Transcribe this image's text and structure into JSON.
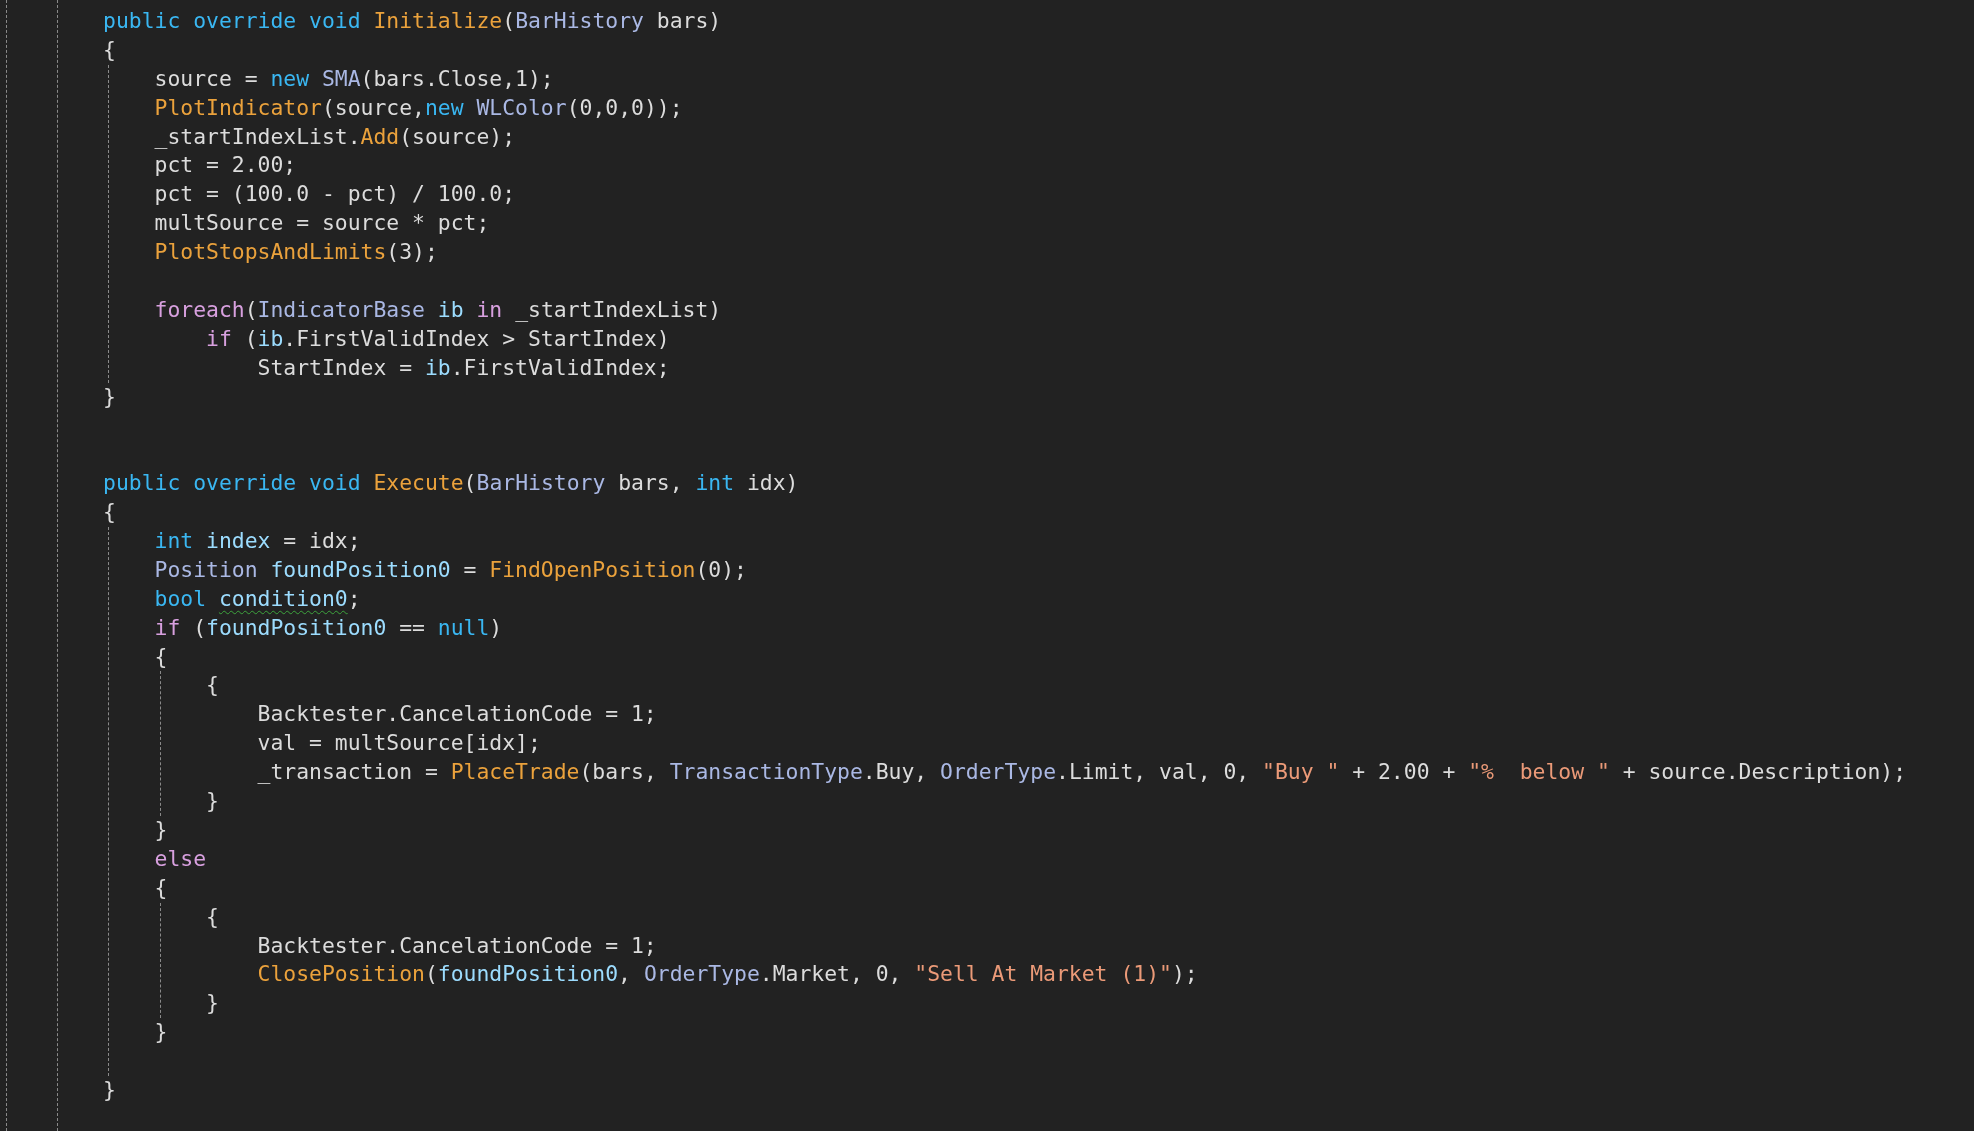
{
  "editor": {
    "code": [
      {
        "kind": "line",
        "tokens": [
          {
            "text": "public override void ",
            "kind": "keyword"
          },
          {
            "text": "Initialize",
            "kind": "method"
          },
          {
            "text": "(",
            "kind": "plain"
          },
          {
            "text": "BarHistory",
            "kind": "type"
          },
          {
            "text": " bars)",
            "kind": "plain"
          }
        ]
      },
      {
        "kind": "line",
        "tokens": [
          {
            "text": "{",
            "kind": "plain"
          }
        ]
      },
      {
        "kind": "block",
        "guide": true,
        "children": [
          {
            "kind": "line",
            "tokens": [
              {
                "text": "source = ",
                "kind": "plain"
              },
              {
                "text": "new ",
                "kind": "keyword"
              },
              {
                "text": "SMA",
                "kind": "type"
              },
              {
                "text": "(bars.Close,1);",
                "kind": "plain"
              }
            ]
          },
          {
            "kind": "line",
            "tokens": [
              {
                "text": "PlotIndicator",
                "kind": "method"
              },
              {
                "text": "(source,",
                "kind": "plain"
              },
              {
                "text": "new ",
                "kind": "keyword"
              },
              {
                "text": "WLColor",
                "kind": "type"
              },
              {
                "text": "(0,0,0));",
                "kind": "plain"
              }
            ]
          },
          {
            "kind": "line",
            "tokens": [
              {
                "text": "_startIndexList.",
                "kind": "plain"
              },
              {
                "text": "Add",
                "kind": "method"
              },
              {
                "text": "(source);",
                "kind": "plain"
              }
            ]
          },
          {
            "kind": "line",
            "tokens": [
              {
                "text": "pct = 2.00;",
                "kind": "plain"
              }
            ]
          },
          {
            "kind": "line",
            "tokens": [
              {
                "text": "pct = (100.0 - pct) / 100.0;",
                "kind": "plain"
              }
            ]
          },
          {
            "kind": "line",
            "tokens": [
              {
                "text": "multSource = source * pct;",
                "kind": "plain"
              }
            ]
          },
          {
            "kind": "line",
            "tokens": [
              {
                "text": "PlotStopsAndLimits",
                "kind": "method"
              },
              {
                "text": "(3);",
                "kind": "plain"
              }
            ]
          },
          {
            "kind": "blank"
          },
          {
            "kind": "line",
            "tokens": [
              {
                "text": "foreach",
                "kind": "control"
              },
              {
                "text": "(",
                "kind": "plain"
              },
              {
                "text": "IndicatorBase ",
                "kind": "type"
              },
              {
                "text": "ib ",
                "kind": "local"
              },
              {
                "text": "in",
                "kind": "control"
              },
              {
                "text": " _startIndexList)",
                "kind": "plain"
              }
            ]
          },
          {
            "kind": "block",
            "guide": false,
            "children": [
              {
                "kind": "line",
                "tokens": [
                  {
                    "text": "if",
                    "kind": "control"
                  },
                  {
                    "text": " (",
                    "kind": "plain"
                  },
                  {
                    "text": "ib",
                    "kind": "local"
                  },
                  {
                    "text": ".FirstValidIndex > StartIndex)",
                    "kind": "plain"
                  }
                ]
              },
              {
                "kind": "block",
                "guide": false,
                "children": [
                  {
                    "kind": "line",
                    "tokens": [
                      {
                        "text": "StartIndex = ",
                        "kind": "plain"
                      },
                      {
                        "text": "ib",
                        "kind": "local"
                      },
                      {
                        "text": ".FirstValidIndex;",
                        "kind": "plain"
                      }
                    ]
                  }
                ]
              }
            ]
          }
        ]
      },
      {
        "kind": "line",
        "tokens": [
          {
            "text": "}",
            "kind": "plain"
          }
        ]
      },
      {
        "kind": "blank"
      },
      {
        "kind": "blank"
      },
      {
        "kind": "line",
        "tokens": [
          {
            "text": "public override void ",
            "kind": "keyword"
          },
          {
            "text": "Execute",
            "kind": "method"
          },
          {
            "text": "(",
            "kind": "plain"
          },
          {
            "text": "BarHistory",
            "kind": "type"
          },
          {
            "text": " bars, ",
            "kind": "plain"
          },
          {
            "text": "int",
            "kind": "keyword"
          },
          {
            "text": " idx)",
            "kind": "plain"
          }
        ]
      },
      {
        "kind": "line",
        "tokens": [
          {
            "text": "{",
            "kind": "plain"
          }
        ]
      },
      {
        "kind": "block",
        "guide": true,
        "children": [
          {
            "kind": "line",
            "tokens": [
              {
                "text": "int ",
                "kind": "keyword"
              },
              {
                "text": "index",
                "kind": "local"
              },
              {
                "text": " = idx;",
                "kind": "plain"
              }
            ]
          },
          {
            "kind": "line",
            "tokens": [
              {
                "text": "Position ",
                "kind": "type"
              },
              {
                "text": "foundPosition0",
                "kind": "local"
              },
              {
                "text": " = ",
                "kind": "plain"
              },
              {
                "text": "FindOpenPosition",
                "kind": "method"
              },
              {
                "text": "(0);",
                "kind": "plain"
              }
            ]
          },
          {
            "kind": "line",
            "tokens": [
              {
                "text": "bool ",
                "kind": "keyword"
              },
              {
                "text": "condition0",
                "kind": "local",
                "warning": true
              },
              {
                "text": ";",
                "kind": "plain"
              }
            ]
          },
          {
            "kind": "line",
            "tokens": [
              {
                "text": "if",
                "kind": "control"
              },
              {
                "text": " (",
                "kind": "plain"
              },
              {
                "text": "foundPosition0",
                "kind": "local"
              },
              {
                "text": " == ",
                "kind": "plain"
              },
              {
                "text": "null",
                "kind": "keyword"
              },
              {
                "text": ")",
                "kind": "plain"
              }
            ]
          },
          {
            "kind": "line",
            "tokens": [
              {
                "text": "{",
                "kind": "plain"
              }
            ]
          },
          {
            "kind": "block",
            "guide": true,
            "children": [
              {
                "kind": "line",
                "tokens": [
                  {
                    "text": "{",
                    "kind": "plain"
                  }
                ]
              },
              {
                "kind": "block",
                "guide": false,
                "children": [
                  {
                    "kind": "line",
                    "tokens": [
                      {
                        "text": "Backtester.CancelationCode = 1;",
                        "kind": "plain"
                      }
                    ]
                  },
                  {
                    "kind": "line",
                    "tokens": [
                      {
                        "text": "val = multSource[idx];",
                        "kind": "plain"
                      }
                    ]
                  },
                  {
                    "kind": "line",
                    "tokens": [
                      {
                        "text": "_transaction = ",
                        "kind": "plain"
                      },
                      {
                        "text": "PlaceTrade",
                        "kind": "method"
                      },
                      {
                        "text": "(bars, ",
                        "kind": "plain"
                      },
                      {
                        "text": "TransactionType",
                        "kind": "type"
                      },
                      {
                        "text": ".Buy, ",
                        "kind": "plain"
                      },
                      {
                        "text": "OrderType",
                        "kind": "type"
                      },
                      {
                        "text": ".Limit, val, 0, ",
                        "kind": "plain"
                      },
                      {
                        "text": "\"Buy \"",
                        "kind": "string"
                      },
                      {
                        "text": " + 2.00 + ",
                        "kind": "plain"
                      },
                      {
                        "text": "\"%  below \"",
                        "kind": "string"
                      },
                      {
                        "text": " + source.Description);",
                        "kind": "plain"
                      }
                    ]
                  }
                ]
              },
              {
                "kind": "line",
                "tokens": [
                  {
                    "text": "}",
                    "kind": "plain"
                  }
                ]
              }
            ]
          },
          {
            "kind": "line",
            "tokens": [
              {
                "text": "}",
                "kind": "plain"
              }
            ]
          },
          {
            "kind": "line",
            "tokens": [
              {
                "text": "else",
                "kind": "control"
              }
            ]
          },
          {
            "kind": "line",
            "tokens": [
              {
                "text": "{",
                "kind": "plain"
              }
            ]
          },
          {
            "kind": "block",
            "guide": true,
            "children": [
              {
                "kind": "line",
                "tokens": [
                  {
                    "text": "{",
                    "kind": "plain"
                  }
                ]
              },
              {
                "kind": "block",
                "guide": false,
                "children": [
                  {
                    "kind": "line",
                    "tokens": [
                      {
                        "text": "Backtester.CancelationCode = 1;",
                        "kind": "plain"
                      }
                    ]
                  },
                  {
                    "kind": "line",
                    "tokens": [
                      {
                        "text": "ClosePosition",
                        "kind": "method"
                      },
                      {
                        "text": "(",
                        "kind": "plain"
                      },
                      {
                        "text": "foundPosition0",
                        "kind": "local"
                      },
                      {
                        "text": ", ",
                        "kind": "plain"
                      },
                      {
                        "text": "OrderType",
                        "kind": "type"
                      },
                      {
                        "text": ".Market, 0, ",
                        "kind": "plain"
                      },
                      {
                        "text": "\"Sell At Market (1)\"",
                        "kind": "string"
                      },
                      {
                        "text": ");",
                        "kind": "plain"
                      }
                    ]
                  }
                ]
              },
              {
                "kind": "line",
                "tokens": [
                  {
                    "text": "}",
                    "kind": "plain"
                  }
                ]
              }
            ]
          },
          {
            "kind": "line",
            "tokens": [
              {
                "text": "}",
                "kind": "plain"
              }
            ]
          },
          {
            "kind": "blank"
          }
        ]
      },
      {
        "kind": "line",
        "tokens": [
          {
            "text": "}",
            "kind": "plain"
          }
        ]
      }
    ]
  }
}
